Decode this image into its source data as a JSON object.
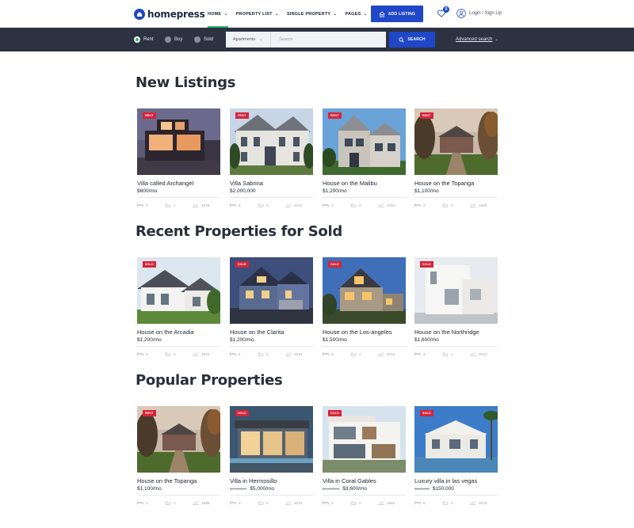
{
  "header": {
    "logo_text": "homepress",
    "nav": [
      {
        "label": "HOME",
        "active": true
      },
      {
        "label": "PROPERTY LIST",
        "active": false
      },
      {
        "label": "SINGLE PROPERTY",
        "active": false
      },
      {
        "label": "PAGES",
        "active": false
      }
    ],
    "add_listing_label": "ADD LISTING",
    "favorites_count": "0",
    "login_label": "Login / Sign Up"
  },
  "search": {
    "options": [
      {
        "label": "Rent",
        "selected": true
      },
      {
        "label": "Buy",
        "selected": false
      },
      {
        "label": "Sold",
        "selected": false
      }
    ],
    "type_value": "Apartments",
    "input_placeholder": "Search",
    "button_label": "SEARCH",
    "advanced_label": "Advanced search"
  },
  "sections": [
    {
      "title": "New Listings",
      "cards": [
        {
          "badge": "RENT",
          "name": "Villa called Archangel",
          "price": "$600/mo",
          "old_price": "",
          "beds": "3",
          "baths": "1",
          "year": "2019",
          "photo": "modern-villa-night"
        },
        {
          "badge": "RENT",
          "name": "Villa Sabrina",
          "price": "$2,000,000",
          "old_price": "",
          "beds": "6",
          "baths": "3",
          "year": "2012",
          "photo": "grey-mansion"
        },
        {
          "badge": "RENT",
          "name": "House on the Malibu",
          "price": "$1,200/mo",
          "old_price": "",
          "beds": "3",
          "baths": "2",
          "year": "2764",
          "photo": "gabled-house"
        },
        {
          "badge": "RENT",
          "name": "House on the Topanga",
          "price": "$1,100/mo",
          "old_price": "",
          "beds": "3",
          "baths": "2",
          "year": "1998",
          "photo": "estate-garden"
        }
      ]
    },
    {
      "title": "Recent Properties for Sold",
      "cards": [
        {
          "badge": "SOLD",
          "name": "House on the Arcadia",
          "price": "$1,200/mo",
          "old_price": "",
          "beds": "3",
          "baths": "2",
          "year": "2012",
          "photo": "white-house"
        },
        {
          "badge": "SOLD",
          "name": "House on the Clarita",
          "price": "$1,200/mo",
          "old_price": "",
          "beds": "4",
          "baths": "2",
          "year": "2018",
          "photo": "blue-dusk-house"
        },
        {
          "badge": "SOLD",
          "name": "House on the Los-angeles",
          "price": "$1,500/mo",
          "old_price": "",
          "beds": "3",
          "baths": "1",
          "year": "2012",
          "photo": "lit-house-dusk"
        },
        {
          "badge": "SOLD",
          "name": "House on the Northridge",
          "price": "$1,600/mo",
          "old_price": "",
          "beds": "3",
          "baths": "2",
          "year": "2013",
          "photo": "white-modern"
        }
      ]
    },
    {
      "title": "Popular Properties",
      "cards": [
        {
          "badge": "RENT",
          "name": "House on the Topanga",
          "price": "$1,100/mo",
          "old_price": "",
          "beds": "3",
          "baths": "2",
          "year": "1998",
          "photo": "estate-garden"
        },
        {
          "badge": "SOLD",
          "name": "Villa in Hermosillo",
          "price": "$5,000/mo",
          "old_price": "$7,000/mo",
          "beds": "5",
          "baths": "3",
          "year": "2019",
          "photo": "glass-villa-night"
        },
        {
          "badge": "SOLD",
          "name": "Villa in Coral Gables",
          "price": "$3,600/mo",
          "old_price": "$4,500/mo",
          "beds": "4",
          "baths": "2",
          "year": "1982",
          "photo": "modern-white-villa"
        },
        {
          "badge": "SOLD",
          "name": "Luxury villa in las vegas",
          "price": "$150,000",
          "old_price": "$180,000",
          "beds": "6",
          "baths": "3",
          "year": "2019",
          "photo": "palm-villa"
        }
      ]
    }
  ],
  "colors": {
    "brand": "#1f47c7",
    "searchbar": "#2d3241",
    "badge": "#d6243a",
    "active_green": "#25b865"
  }
}
